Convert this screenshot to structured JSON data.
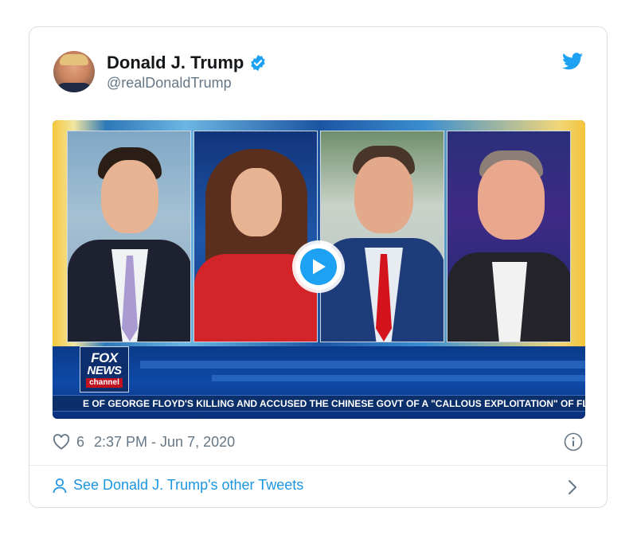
{
  "tweet": {
    "author_name": "Donald J. Trump",
    "handle": "@realDonaldTrump",
    "like_count": "6",
    "timestamp": "2:37 PM - Jun 7, 2020",
    "footer_link": "See Donald J. Trump's other Tweets"
  },
  "video": {
    "logo_fox": "FOX",
    "logo_news": "NEWS",
    "logo_channel": "channel",
    "ticker": "E OF GEORGE FLOYD'S KILLING AND ACCUSED THE CHINESE GOVT OF A \"CALLOUS EXPLOITATION\" OF FLO"
  },
  "icons": {
    "verified": "verified-badge-icon",
    "brand": "twitter-bird-icon",
    "like": "heart-icon",
    "info": "info-icon",
    "profile": "person-icon",
    "chevron": "chevron-right-icon",
    "play": "play-icon"
  },
  "colors": {
    "accent": "#1da1f2",
    "link": "#1b95e0",
    "muted": "#657786",
    "text": "#14171a",
    "border": "#d9dee2"
  }
}
